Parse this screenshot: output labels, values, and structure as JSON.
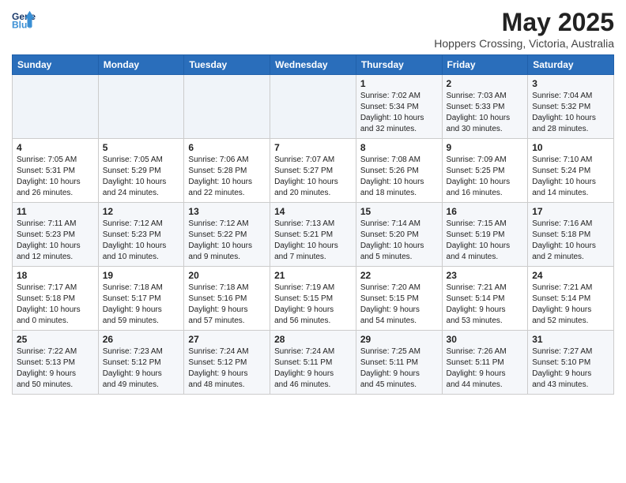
{
  "header": {
    "logo_line1": "General",
    "logo_line2": "Blue",
    "month": "May 2025",
    "location": "Hoppers Crossing, Victoria, Australia"
  },
  "weekdays": [
    "Sunday",
    "Monday",
    "Tuesday",
    "Wednesday",
    "Thursday",
    "Friday",
    "Saturday"
  ],
  "weeks": [
    [
      {
        "day": "",
        "info": ""
      },
      {
        "day": "",
        "info": ""
      },
      {
        "day": "",
        "info": ""
      },
      {
        "day": "",
        "info": ""
      },
      {
        "day": "1",
        "info": "Sunrise: 7:02 AM\nSunset: 5:34 PM\nDaylight: 10 hours\nand 32 minutes."
      },
      {
        "day": "2",
        "info": "Sunrise: 7:03 AM\nSunset: 5:33 PM\nDaylight: 10 hours\nand 30 minutes."
      },
      {
        "day": "3",
        "info": "Sunrise: 7:04 AM\nSunset: 5:32 PM\nDaylight: 10 hours\nand 28 minutes."
      }
    ],
    [
      {
        "day": "4",
        "info": "Sunrise: 7:05 AM\nSunset: 5:31 PM\nDaylight: 10 hours\nand 26 minutes."
      },
      {
        "day": "5",
        "info": "Sunrise: 7:05 AM\nSunset: 5:29 PM\nDaylight: 10 hours\nand 24 minutes."
      },
      {
        "day": "6",
        "info": "Sunrise: 7:06 AM\nSunset: 5:28 PM\nDaylight: 10 hours\nand 22 minutes."
      },
      {
        "day": "7",
        "info": "Sunrise: 7:07 AM\nSunset: 5:27 PM\nDaylight: 10 hours\nand 20 minutes."
      },
      {
        "day": "8",
        "info": "Sunrise: 7:08 AM\nSunset: 5:26 PM\nDaylight: 10 hours\nand 18 minutes."
      },
      {
        "day": "9",
        "info": "Sunrise: 7:09 AM\nSunset: 5:25 PM\nDaylight: 10 hours\nand 16 minutes."
      },
      {
        "day": "10",
        "info": "Sunrise: 7:10 AM\nSunset: 5:24 PM\nDaylight: 10 hours\nand 14 minutes."
      }
    ],
    [
      {
        "day": "11",
        "info": "Sunrise: 7:11 AM\nSunset: 5:23 PM\nDaylight: 10 hours\nand 12 minutes."
      },
      {
        "day": "12",
        "info": "Sunrise: 7:12 AM\nSunset: 5:23 PM\nDaylight: 10 hours\nand 10 minutes."
      },
      {
        "day": "13",
        "info": "Sunrise: 7:12 AM\nSunset: 5:22 PM\nDaylight: 10 hours\nand 9 minutes."
      },
      {
        "day": "14",
        "info": "Sunrise: 7:13 AM\nSunset: 5:21 PM\nDaylight: 10 hours\nand 7 minutes."
      },
      {
        "day": "15",
        "info": "Sunrise: 7:14 AM\nSunset: 5:20 PM\nDaylight: 10 hours\nand 5 minutes."
      },
      {
        "day": "16",
        "info": "Sunrise: 7:15 AM\nSunset: 5:19 PM\nDaylight: 10 hours\nand 4 minutes."
      },
      {
        "day": "17",
        "info": "Sunrise: 7:16 AM\nSunset: 5:18 PM\nDaylight: 10 hours\nand 2 minutes."
      }
    ],
    [
      {
        "day": "18",
        "info": "Sunrise: 7:17 AM\nSunset: 5:18 PM\nDaylight: 10 hours\nand 0 minutes."
      },
      {
        "day": "19",
        "info": "Sunrise: 7:18 AM\nSunset: 5:17 PM\nDaylight: 9 hours\nand 59 minutes."
      },
      {
        "day": "20",
        "info": "Sunrise: 7:18 AM\nSunset: 5:16 PM\nDaylight: 9 hours\nand 57 minutes."
      },
      {
        "day": "21",
        "info": "Sunrise: 7:19 AM\nSunset: 5:15 PM\nDaylight: 9 hours\nand 56 minutes."
      },
      {
        "day": "22",
        "info": "Sunrise: 7:20 AM\nSunset: 5:15 PM\nDaylight: 9 hours\nand 54 minutes."
      },
      {
        "day": "23",
        "info": "Sunrise: 7:21 AM\nSunset: 5:14 PM\nDaylight: 9 hours\nand 53 minutes."
      },
      {
        "day": "24",
        "info": "Sunrise: 7:21 AM\nSunset: 5:14 PM\nDaylight: 9 hours\nand 52 minutes."
      }
    ],
    [
      {
        "day": "25",
        "info": "Sunrise: 7:22 AM\nSunset: 5:13 PM\nDaylight: 9 hours\nand 50 minutes."
      },
      {
        "day": "26",
        "info": "Sunrise: 7:23 AM\nSunset: 5:12 PM\nDaylight: 9 hours\nand 49 minutes."
      },
      {
        "day": "27",
        "info": "Sunrise: 7:24 AM\nSunset: 5:12 PM\nDaylight: 9 hours\nand 48 minutes."
      },
      {
        "day": "28",
        "info": "Sunrise: 7:24 AM\nSunset: 5:11 PM\nDaylight: 9 hours\nand 46 minutes."
      },
      {
        "day": "29",
        "info": "Sunrise: 7:25 AM\nSunset: 5:11 PM\nDaylight: 9 hours\nand 45 minutes."
      },
      {
        "day": "30",
        "info": "Sunrise: 7:26 AM\nSunset: 5:11 PM\nDaylight: 9 hours\nand 44 minutes."
      },
      {
        "day": "31",
        "info": "Sunrise: 7:27 AM\nSunset: 5:10 PM\nDaylight: 9 hours\nand 43 minutes."
      }
    ]
  ]
}
